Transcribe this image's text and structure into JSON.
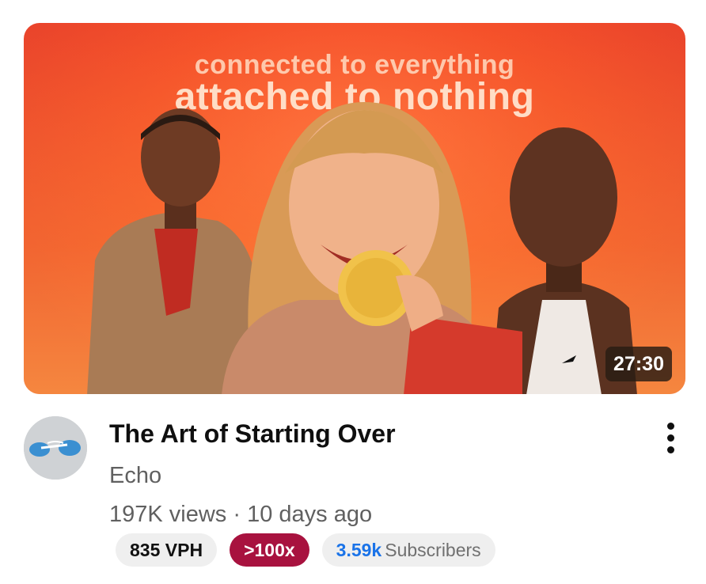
{
  "video": {
    "thumbnail": {
      "headline_small": "connected to everything",
      "headline_large": "attached to nothing",
      "duration": "27:30"
    },
    "title": "The Art of Starting Over",
    "channel": "Echo",
    "views": "197K views",
    "separator": "·",
    "age": "10 days ago",
    "menu_icon": "more-vert-icon"
  },
  "badges": {
    "vph": "835 VPH",
    "ratio": ">100x",
    "subscribers_count": "3.59k",
    "subscribers_label": "Subscribers"
  },
  "colors": {
    "thumbnail_bg": "#f5502a",
    "ratio_badge": "#a8123f",
    "subscriber_count": "#1a73e8"
  }
}
